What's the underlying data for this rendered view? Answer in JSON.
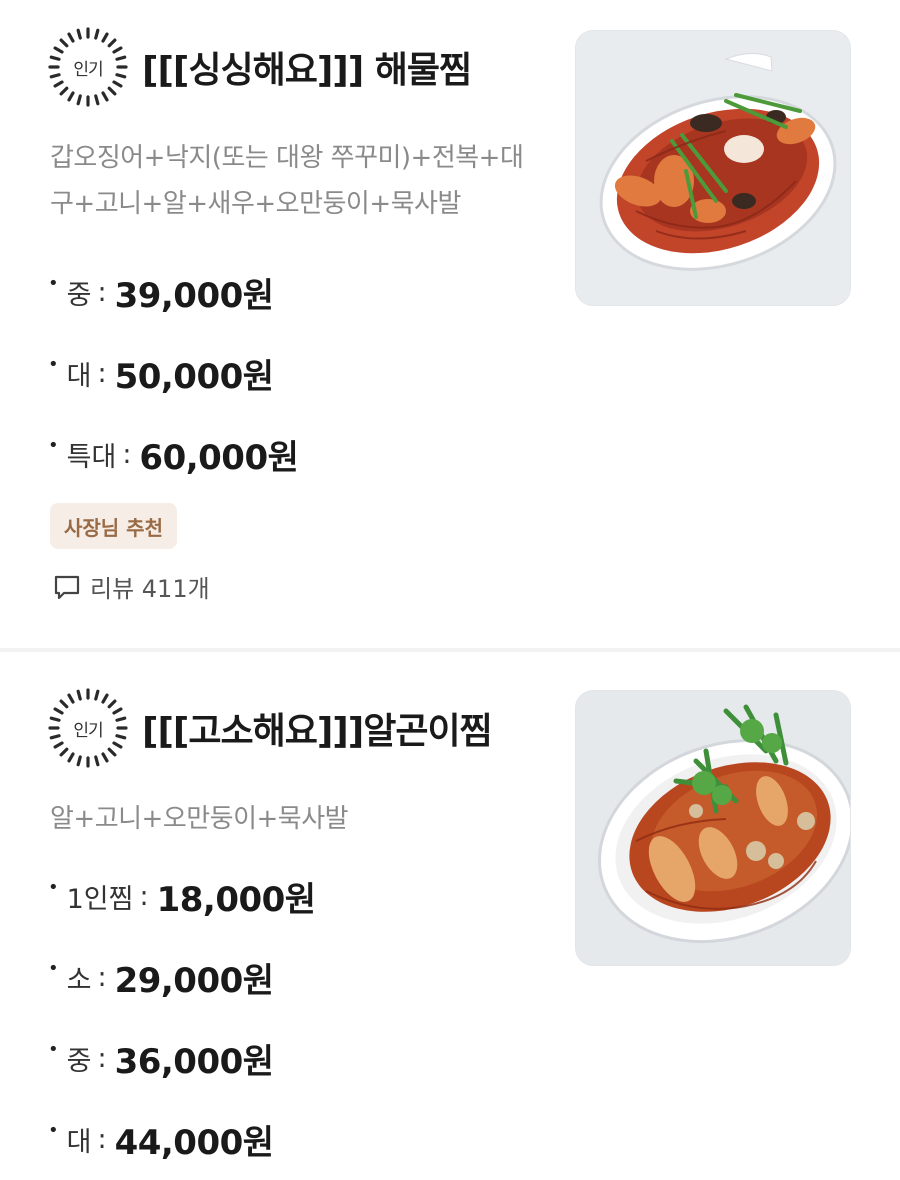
{
  "colors": {
    "title": "#1a1a1a",
    "description": "#8a8a8a",
    "tag_background": "#f5ede6",
    "tag_text": "#9a6a44",
    "divider": "#f2f2f2"
  },
  "menu": [
    {
      "badge": "인기",
      "badge_icon": "sunburst-badge-icon",
      "title": "[[[싱싱해요]]] 해물찜",
      "description": "갑오징어+낙지(또는 대왕 쭈꾸미)+전복+대구+고니+알+새우+오만둥이+묵사발",
      "prices": [
        {
          "label": "중",
          "separator": ":",
          "value": "39,000원"
        },
        {
          "label": "대",
          "separator": ":",
          "value": "50,000원"
        },
        {
          "label": "특대",
          "separator": ":",
          "value": "60,000원"
        }
      ],
      "tag": "사장님 추천",
      "review_icon": "speech-bubble-icon",
      "review_text": "리뷰 411개",
      "image_icon": "seafood-jjim-photo"
    },
    {
      "badge": "인기",
      "badge_icon": "sunburst-badge-icon",
      "title": "[[[고소해요]]]알곤이찜",
      "description": "알+고니+오만둥이+묵사발",
      "prices": [
        {
          "label": "1인찜",
          "separator": ":",
          "value": "18,000원"
        },
        {
          "label": "소",
          "separator": ":",
          "value": "29,000원"
        },
        {
          "label": "중",
          "separator": ":",
          "value": "36,000원"
        },
        {
          "label": "대",
          "separator": ":",
          "value": "44,000원"
        }
      ],
      "image_icon": "algoni-jjim-photo"
    }
  ]
}
